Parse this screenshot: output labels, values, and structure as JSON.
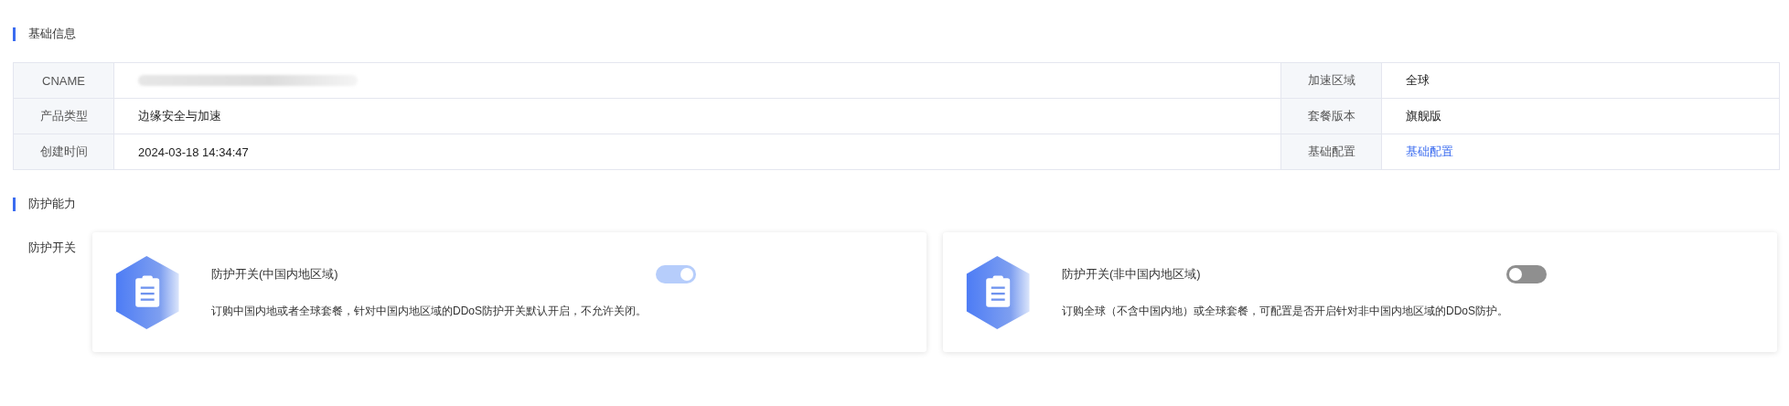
{
  "basic_info": {
    "title": "基础信息",
    "rows": [
      {
        "label": "CNAME",
        "value_redacted": true,
        "label_2": "加速区域",
        "value_2": {
          "kind": "text",
          "text": "全球"
        }
      },
      {
        "label": "产品类型",
        "value": "边缘安全与加速",
        "label_2": "套餐版本",
        "value_2": {
          "kind": "text",
          "text": "旗舰版"
        }
      },
      {
        "label": "创建时间",
        "value": "2024-03-18 14:34:47",
        "label_2": "基础配置",
        "value_2": {
          "kind": "link",
          "text": "基础配置"
        }
      }
    ]
  },
  "protection": {
    "title": "防护能力",
    "label": "防护开关",
    "cards": [
      {
        "title": "防护开关(中国内地区域)",
        "on": true,
        "disabled": true,
        "description": "订购中国内地或者全球套餐，针对中国内地区域的DDoS防护开关默认开启，不允许关闭。"
      },
      {
        "title": "防护开关(非中国内地区域)",
        "on": false,
        "disabled": false,
        "description": "订购全球（不含中国内地）或全球套餐，可配置是否开启针对非中国内地区域的DDoS防护。"
      }
    ]
  }
}
